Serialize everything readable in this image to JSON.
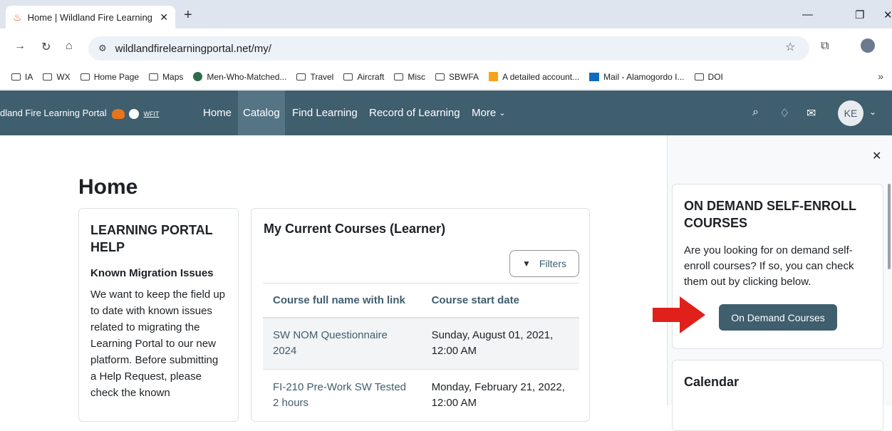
{
  "browser": {
    "tab_title": "Home | Wildland Fire Learning I",
    "url": "wildlandfirelearningportal.net/my/",
    "bookmarks": [
      {
        "label": "IA",
        "icon": "folder-icon"
      },
      {
        "label": "WX",
        "icon": "folder-icon"
      },
      {
        "label": "Home Page",
        "icon": "folder-icon"
      },
      {
        "label": "Maps",
        "icon": "folder-icon"
      },
      {
        "label": "Men-Who-Matched...",
        "icon": "site-icon"
      },
      {
        "label": "Travel",
        "icon": "folder-icon"
      },
      {
        "label": "Aircraft",
        "icon": "folder-icon"
      },
      {
        "label": "Misc",
        "icon": "folder-icon"
      },
      {
        "label": "SBWFA",
        "icon": "folder-icon"
      },
      {
        "label": "A detailed account...",
        "icon": "site-icon"
      },
      {
        "label": "Mail - Alamogordo I...",
        "icon": "mail-icon"
      },
      {
        "label": "DOI",
        "icon": "folder-icon"
      }
    ]
  },
  "site": {
    "brand": "dland Fire Learning Portal",
    "brand_logo_text": "WFIT",
    "nav": [
      "Home",
      "Catalog",
      "Find Learning",
      "Record of Learning",
      "More"
    ],
    "avatar_initials": "KE"
  },
  "page": {
    "title": "Home",
    "help": {
      "heading": "LEARNING PORTAL HELP",
      "subheading": "Known Migration Issues",
      "body": "We want to keep the field up to date with known issues related to migrating the Learning Portal to our new platform. Before submitting a Help Request, please check the known"
    },
    "courses": {
      "heading": "My Current Courses (Learner)",
      "filters_label": "Filters",
      "columns": [
        "Course full name with link",
        "Course start date"
      ],
      "rows": [
        {
          "name": "SW NOM Questionnaire 2024",
          "start": "Sunday, August 01, 2021, 12:00 AM"
        },
        {
          "name": "FI-210 Pre-Work SW Tested 2 hours",
          "start": "Monday, February 21, 2022, 12:00 AM"
        }
      ]
    }
  },
  "drawer": {
    "ondemand": {
      "heading": "ON DEMAND SELF-ENROLL COURSES",
      "body": "Are you looking for on demand self-enroll courses? If so, you can check them out by clicking below.",
      "button": "On Demand Courses"
    },
    "calendar": {
      "heading": "Calendar"
    }
  },
  "colors": {
    "navbar": "#3f5e6e",
    "accent": "#3f5e6e",
    "arrow": "#e0201b"
  }
}
